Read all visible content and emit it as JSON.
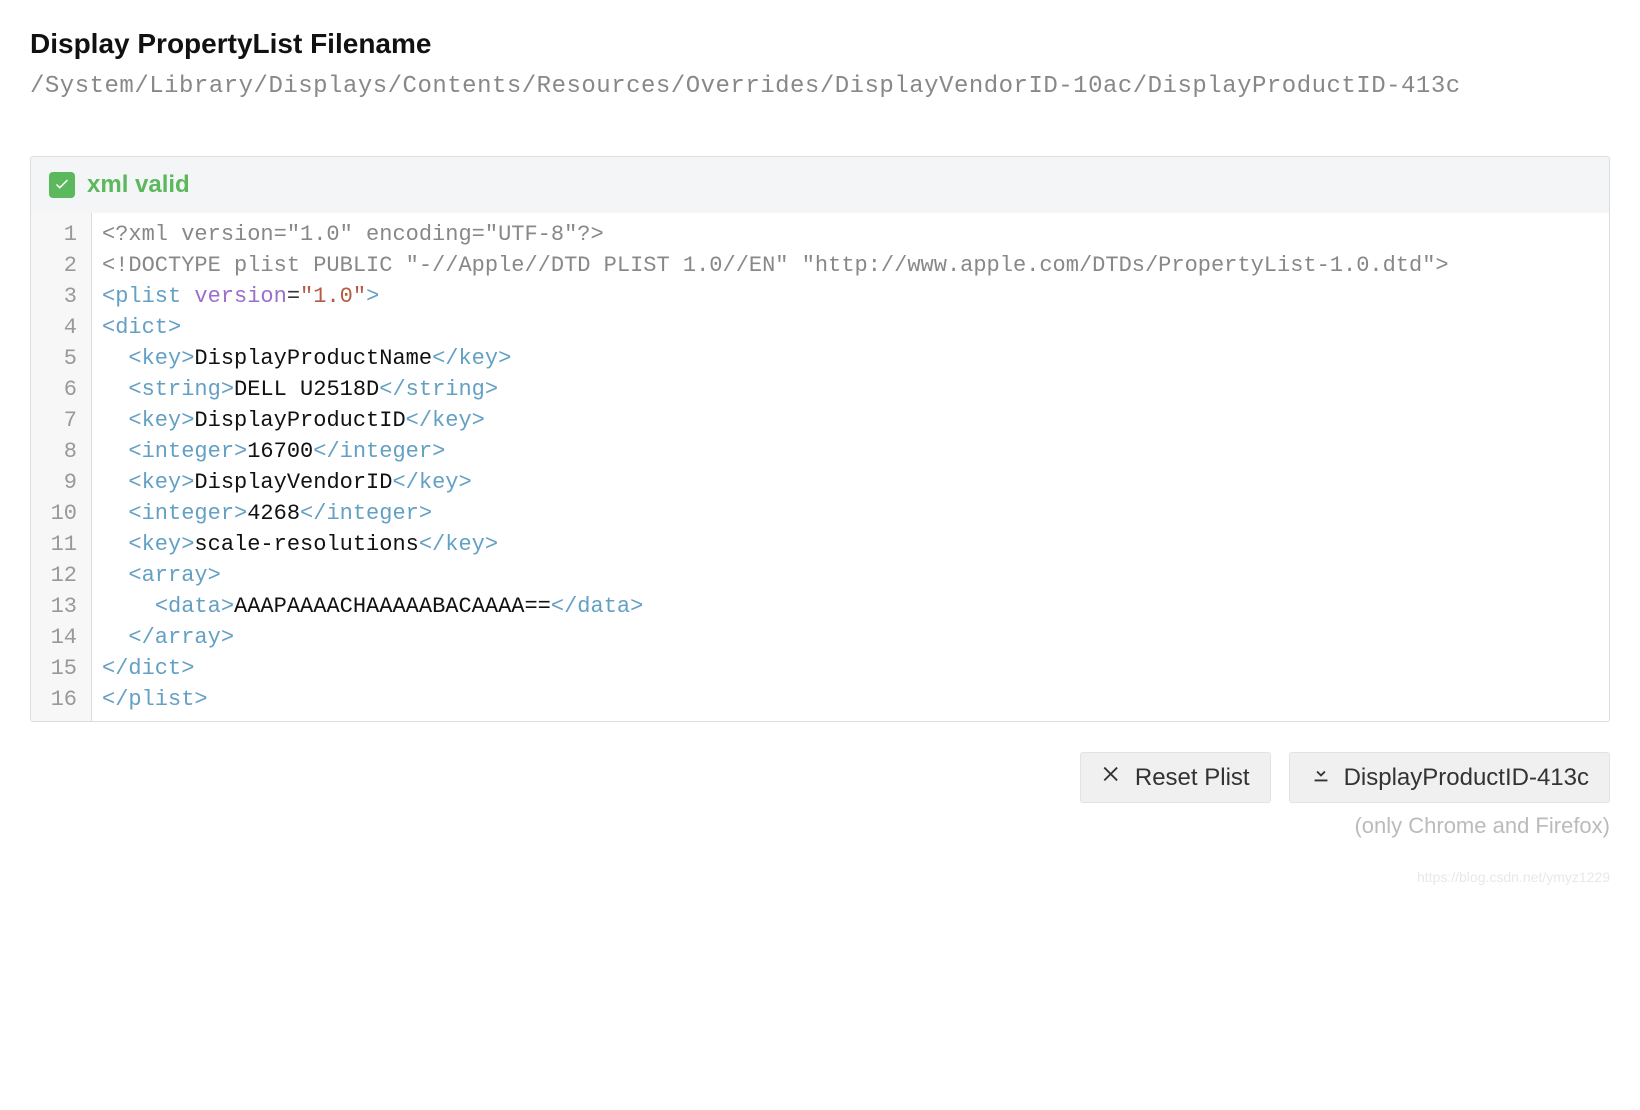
{
  "header": {
    "title": "Display PropertyList Filename",
    "path": "/System/Library/Displays/Contents/Resources/Overrides/DisplayVendorID-10ac/DisplayProductID-413c"
  },
  "status": {
    "label": "xml valid",
    "ok": true
  },
  "code": {
    "lines": [
      "<?xml version=\"1.0\" encoding=\"UTF-8\"?>",
      "<!DOCTYPE plist PUBLIC \"-//Apple//DTD PLIST 1.0//EN\" \"http://www.apple.com/DTDs/PropertyList-1.0.dtd\">",
      "<plist version=\"1.0\">",
      "<dict>",
      "  <key>DisplayProductName</key>",
      "  <string>DELL U2518D</string>",
      "  <key>DisplayProductID</key>",
      "  <integer>16700</integer>",
      "  <key>DisplayVendorID</key>",
      "  <integer>4268</integer>",
      "  <key>scale-resolutions</key>",
      "  <array>",
      "    <data>AAAPAAAACHAAAAABACAAAA==</data>",
      "  </array>",
      "</dict>",
      "</plist>"
    ],
    "values": {
      "DisplayProductName": "DELL U2518D",
      "DisplayProductID": 16700,
      "DisplayVendorID": 4268,
      "scale-resolutions": [
        "AAAPAAAACHAAAAABACAAAA=="
      ]
    }
  },
  "buttons": {
    "reset": "Reset Plist",
    "download": "DisplayProductID-413c"
  },
  "note": "(only Chrome and Firefox)",
  "watermark": "https://blog.csdn.net/ymyz1229"
}
